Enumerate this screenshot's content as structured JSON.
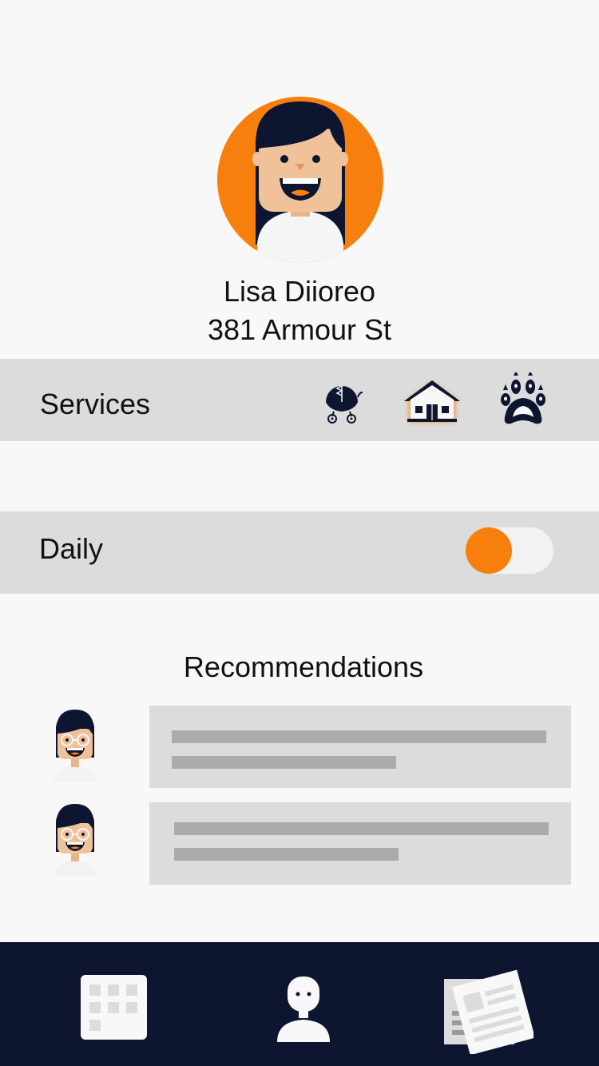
{
  "profile": {
    "name": "Lisa Diioreo",
    "address": "381 Armour St",
    "avatar_icon": "woman-avatar-icon"
  },
  "services": {
    "label": "Services",
    "items": [
      {
        "icon": "stroller-icon",
        "selected": false
      },
      {
        "icon": "house-icon",
        "selected": true
      },
      {
        "icon": "paw-icon",
        "selected": false
      }
    ]
  },
  "daily": {
    "label": "Daily",
    "toggle_on": true
  },
  "recommendations": {
    "title": "Recommendations",
    "items": [
      {
        "avatar_icon": "woman-glasses-avatar-icon"
      },
      {
        "avatar_icon": "woman-glasses-avatar-icon"
      }
    ]
  },
  "nav": {
    "items": [
      {
        "icon": "grid-icon"
      },
      {
        "icon": "profile-icon"
      },
      {
        "icon": "newspaper-icon"
      }
    ]
  },
  "colors": {
    "accent": "#f77f0d",
    "navy": "#0d1530",
    "band": "#dcdcdc",
    "background": "#f8f8f8",
    "skeleton": "#ababab"
  }
}
